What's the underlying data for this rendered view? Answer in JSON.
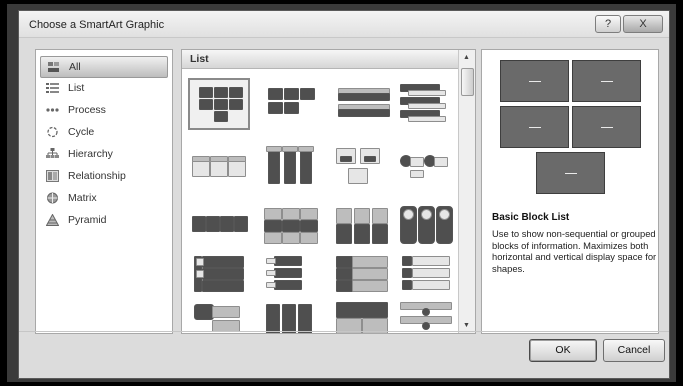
{
  "window": {
    "title": "Choose a SmartArt Graphic",
    "help_label": "?",
    "close_label": "X"
  },
  "sidebar": {
    "items": [
      {
        "label": "All",
        "icon": "all-icon"
      },
      {
        "label": "List",
        "icon": "list-icon"
      },
      {
        "label": "Process",
        "icon": "process-icon"
      },
      {
        "label": "Cycle",
        "icon": "cycle-icon"
      },
      {
        "label": "Hierarchy",
        "icon": "hierarchy-icon"
      },
      {
        "label": "Relationship",
        "icon": "relationship-icon"
      },
      {
        "label": "Matrix",
        "icon": "matrix-icon"
      },
      {
        "label": "Pyramid",
        "icon": "pyramid-icon"
      }
    ],
    "selected": "All"
  },
  "gallery": {
    "header": "List",
    "selected_item": "Basic Block List"
  },
  "details": {
    "title": "Basic Block List",
    "description": "Use to show non-sequential or grouped blocks of information. Maximizes both horizontal and vertical display space for shapes."
  },
  "footer": {
    "ok_label": "OK",
    "cancel_label": "Cancel"
  },
  "colors": {
    "window_background": "#dcdcdc",
    "panel_background": "#ffffff",
    "block_fill": "#6a6a6a"
  }
}
